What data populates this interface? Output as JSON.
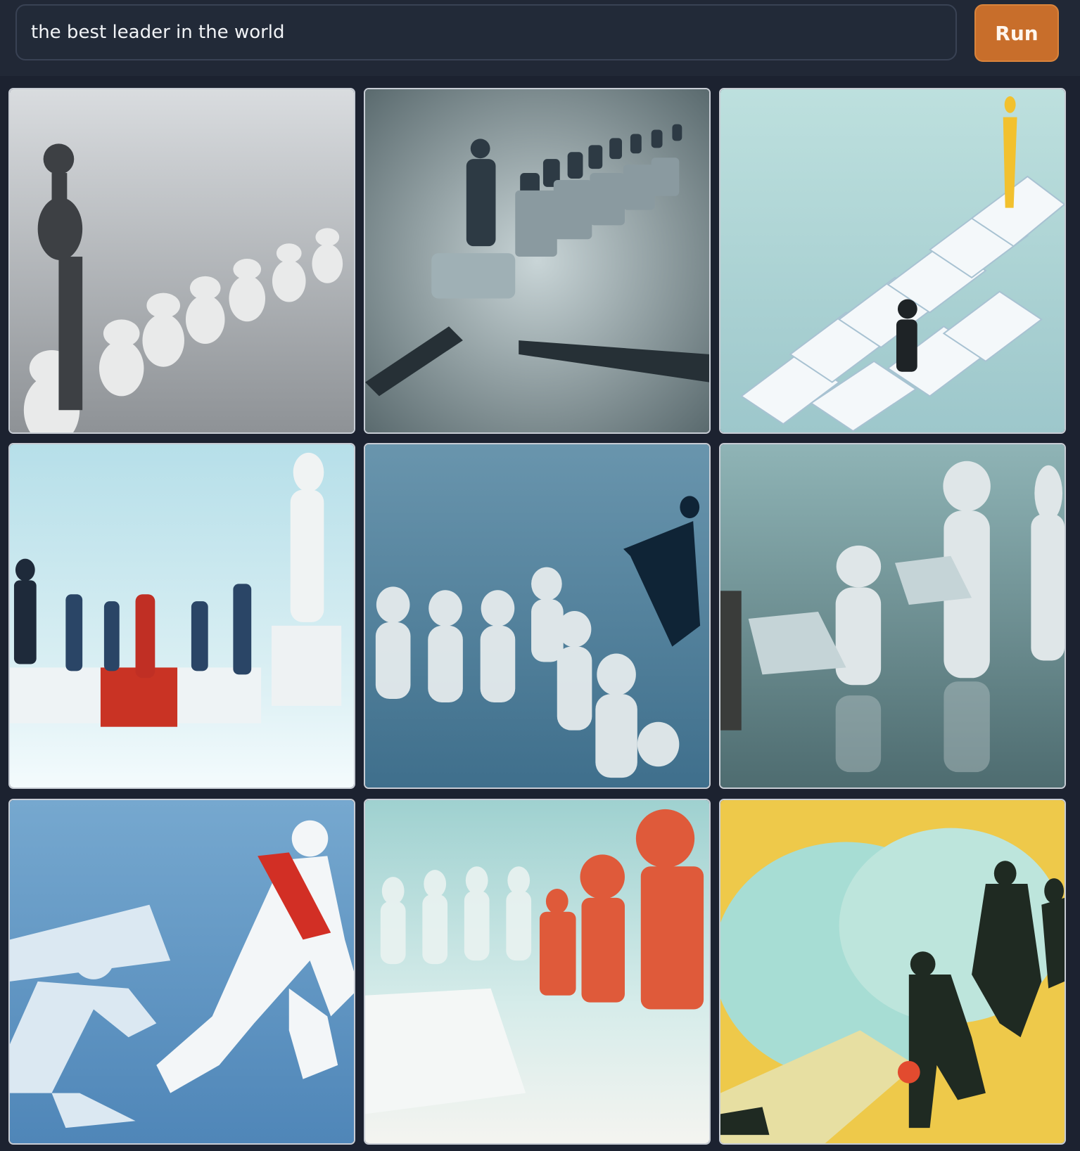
{
  "prompt": {
    "value": "the best leader in the world"
  },
  "run_button": {
    "label": "Run"
  },
  "accent_color": "#c86e2b",
  "gallery": {
    "items": [
      {
        "name": "generated-image-1"
      },
      {
        "name": "generated-image-2"
      },
      {
        "name": "generated-image-3"
      },
      {
        "name": "generated-image-4"
      },
      {
        "name": "generated-image-5"
      },
      {
        "name": "generated-image-6"
      },
      {
        "name": "generated-image-7"
      },
      {
        "name": "generated-image-8"
      },
      {
        "name": "generated-image-9"
      }
    ]
  }
}
